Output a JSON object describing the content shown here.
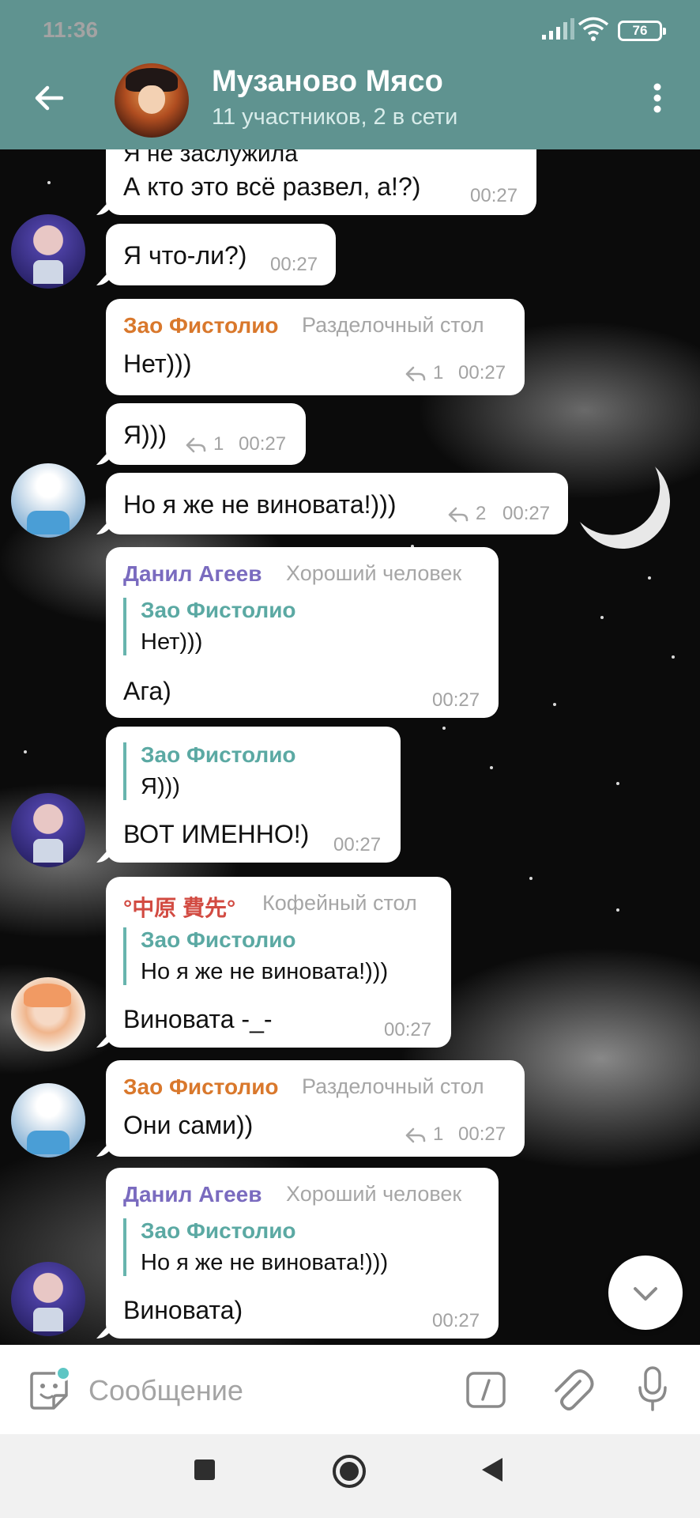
{
  "status_bar": {
    "time": "11:36",
    "battery": "76"
  },
  "header": {
    "title": "Музаново Мясо",
    "subtitle": "11 участников, 2 в сети"
  },
  "messages": [
    {
      "partial_text": "Я не заслужила",
      "text": "А кто это всё развел, а!?)",
      "time": "00:27"
    },
    {
      "text": "Я что-ли?)",
      "time": "00:27"
    },
    {
      "sender": "Зао Фистолио",
      "role": "Разделочный стол",
      "text": "Нет)))",
      "replies": "1",
      "time": "00:27"
    },
    {
      "text": "Я)))",
      "replies": "1",
      "time": "00:27"
    },
    {
      "text": "Но я же не виновата!)))",
      "replies": "2",
      "time": "00:27"
    },
    {
      "sender": "Данил Агеев",
      "role": "Хороший человек",
      "quote_name": "Зао Фистолио",
      "quote_text": "Нет)))",
      "text": "Ага)",
      "time": "00:27"
    },
    {
      "quote_name": "Зао Фистолио",
      "quote_text": "Я)))",
      "text": "ВОТ ИМЕННО!)",
      "time": "00:27"
    },
    {
      "sender": "°中原 費先°",
      "role": "Кофейный стол",
      "quote_name": "Зао Фистолио",
      "quote_text": "Но я же не виновата!)))",
      "text": "Виновата -_-",
      "time": "00:27"
    },
    {
      "sender": "Зао Фистолио",
      "role": "Разделочный стол",
      "text": "Они сами))",
      "replies": "1",
      "time": "00:27"
    },
    {
      "sender": "Данил Агеев",
      "role": "Хороший человек",
      "quote_name": "Зао Фистолио",
      "quote_text": "Но я же не виновата!)))",
      "text": "Виновата)",
      "time": "00:27"
    }
  ],
  "input": {
    "placeholder": "Сообщение"
  },
  "colors": {
    "header": "#5f9390",
    "sender_orange": "#d9782c",
    "sender_purple": "#7a6bbf",
    "sender_red": "#d24b42",
    "quote_teal": "#5ba9a3"
  }
}
